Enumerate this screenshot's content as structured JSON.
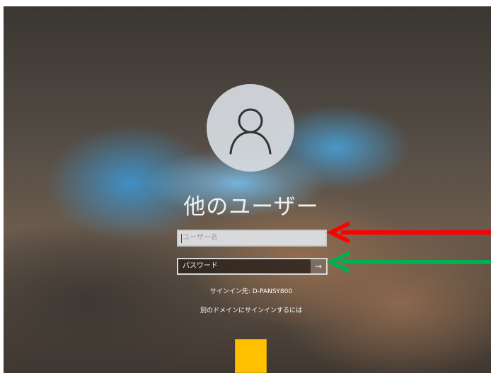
{
  "login": {
    "title": "他のユーザー",
    "username_placeholder": "ユーザー名",
    "password_placeholder": "パスワード",
    "submit_icon": "arrow-right",
    "signin_target": "サインイン先: D-PANSY800",
    "other_domain_link": "別のドメインにサインインするには"
  },
  "annotations": {
    "username_arrow_color": "#ff0000",
    "password_arrow_color": "#00b050",
    "marker_color": "#ffc000"
  }
}
